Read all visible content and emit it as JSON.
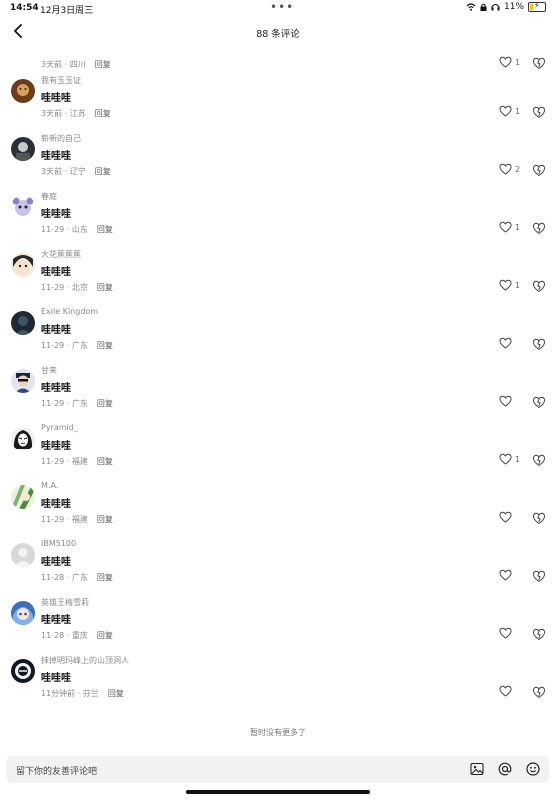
{
  "status": {
    "time": "14:54",
    "date": "12月3日周三",
    "dots": "•••",
    "battery": "11%"
  },
  "nav": {
    "title": "88 条评论"
  },
  "first": {
    "meta_time": "3天前 · 四川",
    "reply": "回复",
    "likes": "1"
  },
  "comments": [
    {
      "user": "我有玉玉证",
      "text": "哇哇哇",
      "time": "3天前 · 江苏",
      "reply": "回复",
      "likes": "1",
      "avatar_color": "#6b3d1a"
    },
    {
      "user": "崭新的自己",
      "text": "哇哇哇",
      "time": "3天前 · 辽宁",
      "reply": "回复",
      "likes": "2",
      "avatar_color": "#2a3038"
    },
    {
      "user": "春庭",
      "text": "哇哇哇",
      "time": "11-29 · 山东",
      "reply": "回复",
      "likes": "1",
      "avatar_color": "#c9c3e8"
    },
    {
      "user": "大花蕉蕉蕉",
      "text": "哇哇哇",
      "time": "11-29 · 北京",
      "reply": "回复",
      "likes": "1",
      "avatar_color": "#e9d7c4"
    },
    {
      "user": "Exile Kingdom",
      "text": "哇哇哇",
      "time": "11-29 · 广东",
      "reply": "回复",
      "likes": "",
      "avatar_color": "#1d2a33"
    },
    {
      "user": "甘来",
      "text": "哇哇哇",
      "time": "11-29 · 广东",
      "reply": "回复",
      "likes": "",
      "avatar_color": "#dfe6ef"
    },
    {
      "user": "Pyramid_",
      "text": "哇哇哇",
      "time": "11-29 · 福建",
      "reply": "回复",
      "likes": "1",
      "avatar_color": "#f0f0f0"
    },
    {
      "user": "M.A.",
      "text": "哇哇哇",
      "time": "11-29 · 福建",
      "reply": "回复",
      "likes": "",
      "avatar_color": "#7cae6e"
    },
    {
      "user": "IBM5100",
      "text": "哇哇哇",
      "time": "11-28 · 广东",
      "reply": "回复",
      "likes": "",
      "avatar_color": "#d8d8d8"
    },
    {
      "user": "英雄王梅雪莉",
      "text": "哇哇哇",
      "time": "11-28 · 重庆",
      "reply": "回复",
      "likes": "",
      "avatar_color": "#3b6fc4"
    },
    {
      "user": "抹掉明玛峰上的山顶洞人",
      "text": "哇哇哇",
      "time": "11分钟前 · 芬兰",
      "reply": "回复",
      "likes": "",
      "avatar_color": "#101820"
    }
  ],
  "footer": {
    "no_more": "暂时没有更多了",
    "placeholder": "留下你的友善评论吧"
  },
  "icons": [
    "back-arrow-icon",
    "heart-icon",
    "dislike-heart-icon",
    "image-icon",
    "at-icon",
    "emoji-icon",
    "wifi-icon",
    "battery-icon"
  ]
}
